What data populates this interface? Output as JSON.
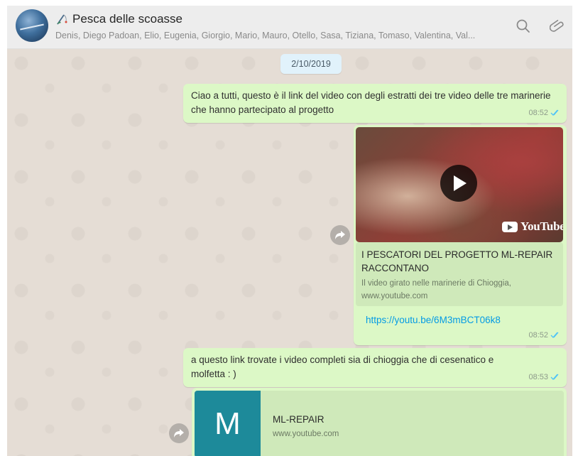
{
  "header": {
    "title": "Pesca delle scoasse",
    "members": "Denis, Diego Padoan, Elio, Eugenia, Giorgio, Mario, Mauro, Otello, Sasa, Tiziana, Tomaso, Valentina, Val..."
  },
  "icons": {
    "avatar": "group-avatar",
    "title": "fishing-rod-icon",
    "search": "search-icon",
    "attach": "paperclip-icon",
    "forward": "forward-icon",
    "play": "play-icon",
    "read": "double-check-icon"
  },
  "colors": {
    "bubble_outgoing": "#dcf8c6",
    "chat_background": "#e5ddd5",
    "link": "#039be5",
    "read_ticks": "#4fc3f7",
    "date_pill": "#e1f2fb"
  },
  "chat": {
    "date": "2/10/2019",
    "messages": [
      {
        "text": "Ciao a tutti, questo è il link del video con degli estratti dei tre video delle tre marinerie che hanno partecipato al progetto",
        "time": "08:52"
      },
      {
        "preview": {
          "brand": "YouTube",
          "title": "I PESCATORI DEL PROGETTO ML-REPAIR RACCONTANO",
          "description": "Il video girato nelle marinerie di Chioggia,",
          "domain": "www.youtube.com"
        },
        "link": "https://youtu.be/6M3mBCT06k8",
        "time": "08:52"
      },
      {
        "text": "a questo link trovate i video completi sia di chioggia che di cesenatico e molfetta : )",
        "time": "08:53"
      },
      {
        "preview": {
          "tile_letter": "M",
          "title": "ML-REPAIR",
          "domain": "www.youtube.com"
        }
      }
    ]
  }
}
